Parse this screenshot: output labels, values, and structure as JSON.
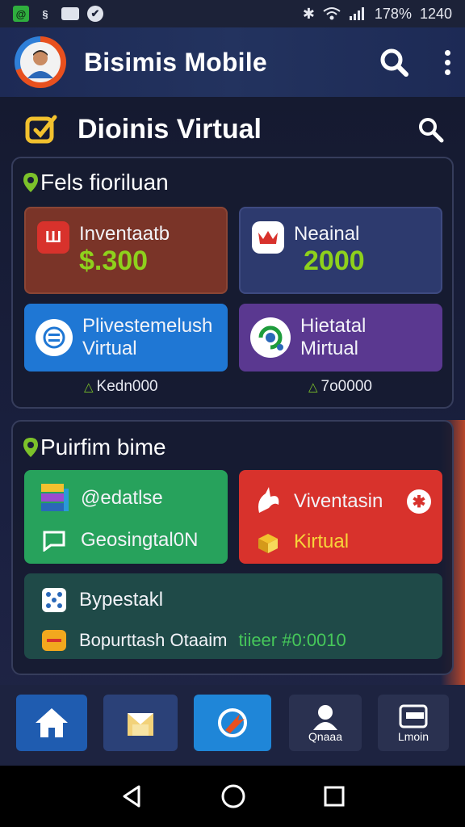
{
  "status_bar": {
    "battery": "178%",
    "time": "1240"
  },
  "app_bar": {
    "title": "Bisimis Mobile"
  },
  "section": {
    "title": "Dioinis Virtual"
  },
  "panel1": {
    "title": "Fels fioriluan",
    "cards": [
      {
        "label": "Inventaatb",
        "value": "$.300"
      },
      {
        "label": "Neainal",
        "value": "2000"
      },
      {
        "label_line1": "Plivestemelush",
        "label_line2": "Virtual"
      },
      {
        "label_line1": "Hietatal",
        "label_line2": "Mirtual"
      }
    ],
    "footnotes": [
      "Kedn000",
      "7o0000"
    ]
  },
  "panel2": {
    "title": "Puirfim bime",
    "cards": [
      {
        "label_line1": "@edatlse",
        "label_line2": "Geosingtal0N"
      },
      {
        "label_line1": "Viventasin",
        "label_line2": "Kirtual"
      },
      {
        "label_line1": "Bypestakl",
        "label_line2": "Bopurttash Otaaim",
        "highlight": "tiieer #0:0010"
      }
    ]
  },
  "bottom_nav": {
    "items": [
      {
        "label": ""
      },
      {
        "label": ""
      },
      {
        "label": ""
      },
      {
        "label": "Qnaaa"
      },
      {
        "label": "Lmoin"
      }
    ]
  },
  "colors": {
    "accent_green": "#8ed11c",
    "card_brown": "#7a3428",
    "card_navy": "#2d3a6e",
    "card_blue": "#1f77d4",
    "card_purple": "#5a3890",
    "card_green": "#27a25c",
    "card_red": "#d8322c",
    "card_teal": "#1f4a48"
  }
}
